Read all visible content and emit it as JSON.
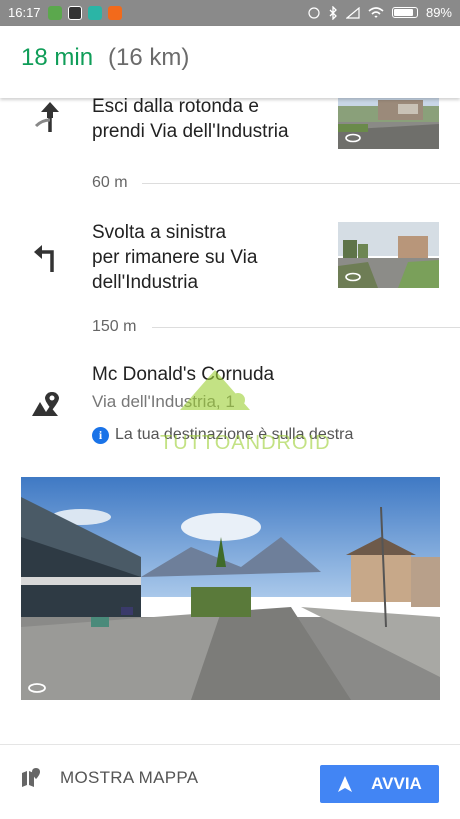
{
  "status_bar": {
    "time": "16:17",
    "battery": "89%"
  },
  "route": {
    "duration": "18 min",
    "distance": "(16 km)"
  },
  "steps": [
    {
      "line1": "Esci dalla rotonda e",
      "line2": "prendi Via dell'Industria",
      "icon": "roundabout-exit-icon"
    },
    {
      "line1": "Svolta a sinistra",
      "line2": "per rimanere su Via",
      "line3": "dell'Industria",
      "icon": "turn-left-icon"
    }
  ],
  "distances": [
    "60 m",
    "150 m"
  ],
  "destination": {
    "name": "Mc Donald's Cornuda",
    "address": "Via dell'Industria, 1",
    "info": "La tua destinazione è sulla destra"
  },
  "watermark": "TUTTOANDROID",
  "bottom": {
    "map_label": "MOSTRA MAPPA",
    "start_label": "AVVIA"
  },
  "colors": {
    "duration": "#0f9d58",
    "accent": "#4285f4",
    "info": "#1a73e8"
  }
}
